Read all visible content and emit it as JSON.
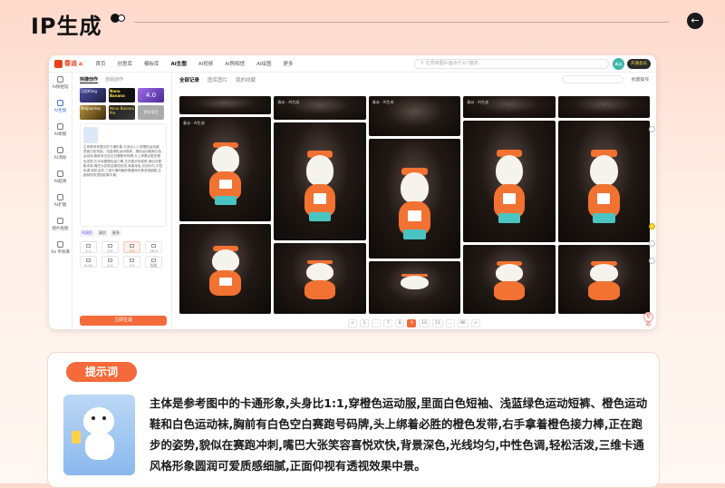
{
  "header": {
    "title": "IP生成"
  },
  "app": {
    "logo": "春派",
    "logo_sup": "Ai",
    "nav": [
      "首页",
      "创意库",
      "模板库",
      "AI生图",
      "AI视频",
      "AI照相馆",
      "AI绘图",
      "更多"
    ],
    "nav_active_index": 3,
    "search_placeholder": "在想用图片画点什么?描述…",
    "avatar_text": "春派",
    "vip_label": "开通会员",
    "sidebar": [
      {
        "label": "AI照相馆",
        "icon": "camera-icon"
      },
      {
        "label": "AI生图",
        "icon": "edit-image-icon"
      },
      {
        "label": "AI修图",
        "icon": "retouch-icon"
      },
      {
        "label": "AI消除",
        "icon": "erase-icon"
      },
      {
        "label": "AI超清",
        "icon": "hd-icon"
      },
      {
        "label": "AI扩图",
        "icon": "expand-icon"
      },
      {
        "label": "图片抠图",
        "icon": "cutout-icon"
      },
      {
        "label": "Aa\n字体库",
        "icon": "font-icon"
      }
    ],
    "sidebar_active_index": 1,
    "panel": {
      "tabs": [
        "快捷创作",
        "自由创作"
      ],
      "models": [
        {
          "label": "可灵Kling"
        },
        {
          "label": "Nano Banana"
        },
        {
          "label": "4.0"
        },
        {
          "label": "Midjourney"
        },
        {
          "label": "Nano Banana Pro"
        },
        {
          "label": "更多模型"
        }
      ],
      "prompt": "主体是参考图中的卡通形象,头身比1:1,穿橙色运动服,里面白色短袖、浅蓝绿色运动短裤、橙色运动鞋和白色运动袜,胸前有白色空白赛跑号码牌,头上绑着必胜的橙色发带,右手拿着橙色接力棒,正在跑步的姿势,貌似在赛跑冲刺,嘴巴大张笑容喜悦欢快,背景深色,光线均匀,中性色调,轻松活泼,三维卡通风格形象圆润可爱质感细腻,正面仰视有透视效果中景。",
      "chips": [
        "AI润色",
        "清空",
        "更多"
      ],
      "ratios": [
        "1:1",
        "3:4",
        "4:3",
        "16:9",
        "9:16",
        "2:3",
        "3:2",
        "智能"
      ],
      "ratio_active_index": 2,
      "generate_label": "立即生成"
    },
    "main": {
      "tabs": [
        "全部记录",
        "图库图片",
        "我的收藏"
      ],
      "batch_label": "批量操作",
      "watermark": "春派 · AI生成",
      "pager": [
        "<",
        "1",
        "...",
        "7",
        "8",
        "9",
        "10",
        "11",
        "...",
        "80",
        ">"
      ],
      "pager_active_index": 5
    },
    "help_label": "帮助"
  },
  "prompt_card": {
    "badge": "提示词",
    "text": "主体是参考图中的卡通形象,头身比1:1,穿橙色运动服,里面白色短袖、浅蓝绿色运动短裤、橙色运动鞋和白色运动袜,胸前有白色空白赛跑号码牌,头上绑着必胜的橙色发带,右手拿着橙色接力棒,正在跑步的姿势,貌似在赛跑冲刺,嘴巴大张笑容喜悦欢快,背景深色,光线均匀,中性色调,轻松活泼,三维卡通风格形象圆润可爱质感细腻,正面仰视有透视效果中景。"
  },
  "colors": {
    "accent": "#f46a3a",
    "brand": "#e8401c",
    "active_blue": "#3a6fe0"
  }
}
